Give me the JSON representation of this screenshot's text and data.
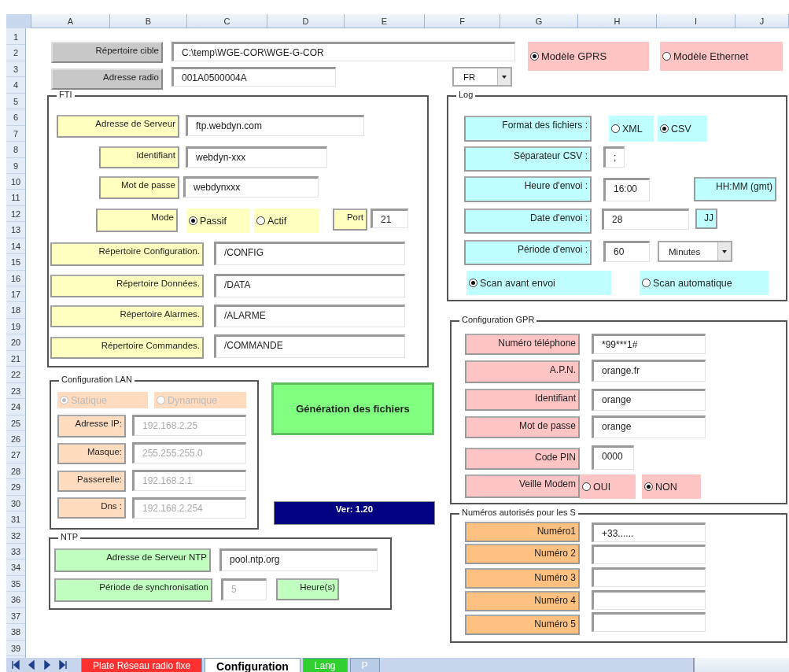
{
  "sheet": {
    "columns": [
      "A",
      "B",
      "C",
      "D",
      "E",
      "F",
      "G",
      "H",
      "I",
      "J"
    ],
    "rows": [
      "1",
      "2",
      "3",
      "4",
      "5",
      "6",
      "7",
      "8",
      "9",
      "10",
      "11",
      "12",
      "13",
      "14",
      "15",
      "16",
      "17",
      "18",
      "19",
      "20",
      "21",
      "22",
      "23",
      "24",
      "25",
      "26",
      "27",
      "28",
      "29",
      "30",
      "31",
      "32",
      "33",
      "34",
      "35",
      "36",
      "37",
      "38",
      "39"
    ]
  },
  "top_controls": [
    {
      "kind": "button",
      "label": "Répertoire cible"
    },
    {
      "kind": "field",
      "value": "C:\\temp\\WGE-COR\\WGE-G-COR",
      "disabled": false
    },
    {
      "kind": "button",
      "label": "Adresse radio"
    },
    {
      "kind": "field",
      "value": "001A0500004A",
      "disabled": false
    },
    {
      "kind": "dropdown",
      "value": "FR"
    },
    {
      "kind": "radio",
      "label": "Modèle GPRS",
      "selected": true,
      "disabled": false
    },
    {
      "kind": "radio",
      "label": "Modèle Ethernet",
      "selected": false,
      "disabled": false
    },
    {
      "kind": "action",
      "label": "Génération des fichiers"
    },
    {
      "kind": "banner",
      "label": "Ver: 1.20"
    }
  ],
  "groups": [
    {
      "title": "FTI",
      "controls": [
        {
          "kind": "label",
          "label": "Adresse de Serveur"
        },
        {
          "kind": "field",
          "value": "ftp.webdyn.com",
          "disabled": false
        },
        {
          "kind": "label",
          "label": "Identifiant"
        },
        {
          "kind": "field",
          "value": "webdyn-xxx",
          "disabled": false
        },
        {
          "kind": "label",
          "label": "Mot de passe"
        },
        {
          "kind": "field",
          "value": "webdynxxx",
          "disabled": false
        },
        {
          "kind": "label",
          "label": "Mode"
        },
        {
          "kind": "radio",
          "label": "Passif",
          "selected": true,
          "disabled": false
        },
        {
          "kind": "radio",
          "label": "Actif",
          "selected": false,
          "disabled": false
        },
        {
          "kind": "label",
          "label": "Port"
        },
        {
          "kind": "field",
          "value": "21",
          "disabled": false
        },
        {
          "kind": "label",
          "label": "Répertoire Configuration."
        },
        {
          "kind": "field",
          "value": "/CONFIG",
          "disabled": false
        },
        {
          "kind": "label",
          "label": "Répertoire Données."
        },
        {
          "kind": "field",
          "value": "/DATA",
          "disabled": false
        },
        {
          "kind": "label",
          "label": "Répertoire Alarmes."
        },
        {
          "kind": "field",
          "value": "/ALARME",
          "disabled": false
        },
        {
          "kind": "label",
          "label": "Répertoire Commandes."
        },
        {
          "kind": "field",
          "value": "/COMMANDE",
          "disabled": false
        }
      ]
    },
    {
      "title": "Configuration LAN",
      "controls": [
        {
          "kind": "radio",
          "label": "Statique",
          "selected": true,
          "disabled": true
        },
        {
          "kind": "radio",
          "label": "Dynamique",
          "selected": false,
          "disabled": true
        },
        {
          "kind": "label",
          "label": "Adresse IP:"
        },
        {
          "kind": "field",
          "value": "192.168.2.25",
          "disabled": true
        },
        {
          "kind": "label",
          "label": "Masque:"
        },
        {
          "kind": "field",
          "value": "255.255.255.0",
          "disabled": true
        },
        {
          "kind": "label",
          "label": "Passerelle:"
        },
        {
          "kind": "field",
          "value": "192.168.2.1",
          "disabled": true
        },
        {
          "kind": "label",
          "label": "Dns :"
        },
        {
          "kind": "field",
          "value": "192.168.2.254",
          "disabled": true
        }
      ]
    },
    {
      "title": "NTP",
      "controls": [
        {
          "kind": "label",
          "label": "Adresse de Serveur NTP"
        },
        {
          "kind": "field",
          "value": "pool.ntp.org",
          "disabled": false
        },
        {
          "kind": "label",
          "label": "Période de synchronisation"
        },
        {
          "kind": "field",
          "value": "5",
          "disabled": true
        },
        {
          "kind": "label",
          "label": "Heure(s)"
        }
      ]
    },
    {
      "title": "Log",
      "controls": [
        {
          "kind": "label",
          "label": "Format des fichiers :"
        },
        {
          "kind": "radio",
          "label": "XML",
          "selected": false,
          "disabled": false
        },
        {
          "kind": "radio",
          "label": "CSV",
          "selected": true,
          "disabled": false
        },
        {
          "kind": "label",
          "label": "Séparateur CSV :"
        },
        {
          "kind": "field",
          "value": ";",
          "disabled": false
        },
        {
          "kind": "label",
          "label": "Heure d'envoi :"
        },
        {
          "kind": "field",
          "value": "16:00",
          "disabled": false
        },
        {
          "kind": "label",
          "label": "HH:MM (gmt)"
        },
        {
          "kind": "label",
          "label": "Date d'envoi :"
        },
        {
          "kind": "field",
          "value": "28",
          "disabled": false
        },
        {
          "kind": "label",
          "label": "JJ"
        },
        {
          "kind": "label",
          "label": "Période d'envoi :"
        },
        {
          "kind": "field",
          "value": "60",
          "disabled": false
        },
        {
          "kind": "dropdown",
          "value": "Minutes"
        },
        {
          "kind": "radio",
          "label": "Scan avant envoi",
          "selected": true,
          "disabled": false
        },
        {
          "kind": "radio",
          "label": "Scan automatique",
          "selected": false,
          "disabled": false
        }
      ]
    },
    {
      "title": "Configuration GPR",
      "controls": [
        {
          "kind": "label",
          "label": "Numéro téléphone"
        },
        {
          "kind": "field",
          "value": "*99***1#",
          "disabled": false
        },
        {
          "kind": "label",
          "label": "A.P.N."
        },
        {
          "kind": "field",
          "value": "orange.fr",
          "disabled": false
        },
        {
          "kind": "label",
          "label": "Identifiant"
        },
        {
          "kind": "field",
          "value": "orange",
          "disabled": false
        },
        {
          "kind": "label",
          "label": "Mot de passe"
        },
        {
          "kind": "field",
          "value": "orange",
          "disabled": false
        },
        {
          "kind": "label",
          "label": "Code PIN"
        },
        {
          "kind": "field",
          "value": "0000",
          "disabled": false
        },
        {
          "kind": "label",
          "label": "Veille Modem"
        },
        {
          "kind": "radio",
          "label": "OUI",
          "selected": false,
          "disabled": false
        },
        {
          "kind": "radio",
          "label": "NON",
          "selected": true,
          "disabled": false
        }
      ]
    },
    {
      "title": "Numéros autorisés pour les S",
      "controls": [
        {
          "kind": "label",
          "label": "Numéro1"
        },
        {
          "kind": "field",
          "value": "+33......",
          "disabled": false
        },
        {
          "kind": "label",
          "label": "Numéro 2"
        },
        {
          "kind": "field"
        },
        {
          "kind": "label",
          "label": "Numéro 3"
        },
        {
          "kind": "field"
        },
        {
          "kind": "label",
          "label": "Numéro 4"
        },
        {
          "kind": "field"
        },
        {
          "kind": "label",
          "label": "Numéro 5"
        },
        {
          "kind": "field"
        }
      ]
    }
  ],
  "sheet_tabs": [
    {
      "label": "Plate Réseau radio fixe",
      "selected": false,
      "color": "#ff3030"
    },
    {
      "label": "Configuration",
      "selected": true,
      "color": "#ffffff"
    },
    {
      "label": "Lang",
      "selected": false,
      "color": "#30d030"
    },
    {
      "label": "P",
      "selected": false,
      "color": "#b8cce8"
    }
  ]
}
